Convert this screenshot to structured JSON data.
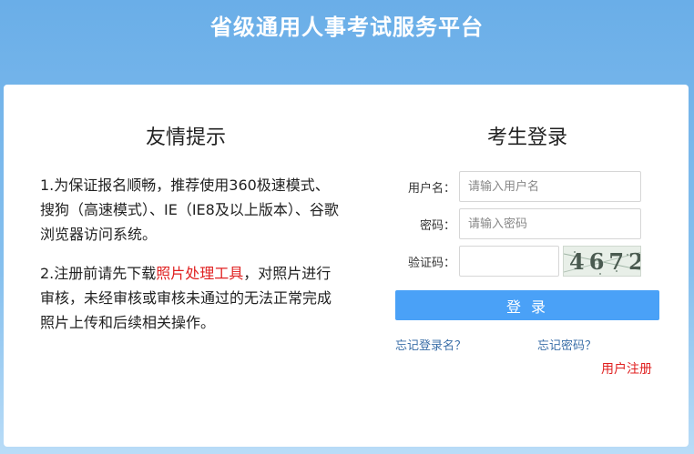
{
  "header": {
    "title": "省级通用人事考试服务平台"
  },
  "tips": {
    "title": "友情提示",
    "item1": "1.为保证报名顺畅，推荐使用360极速模式、搜狗（高速模式）、IE（IE8及以上版本）、谷歌浏览器访问系统。",
    "item2_before": "2.注册前请先下载",
    "item2_link": "照片处理工具",
    "item2_after": "，对照片进行审核，未经审核或审核未通过的无法正常完成照片上传和后续相关操作。"
  },
  "login": {
    "title": "考生登录",
    "username_label": "用户名：",
    "username_placeholder": "请输入用户名",
    "password_label": "密码：",
    "password_placeholder": "请输入密码",
    "captcha_label": "验证码：",
    "captcha_text": "4672",
    "submit_label": "登 录",
    "forgot_username": "忘记登录名？",
    "forgot_password": "忘记密码？",
    "register": "用户注册"
  },
  "colors": {
    "accent": "#4aa1f7",
    "link": "#3b6fa8",
    "alert": "#e02020"
  }
}
